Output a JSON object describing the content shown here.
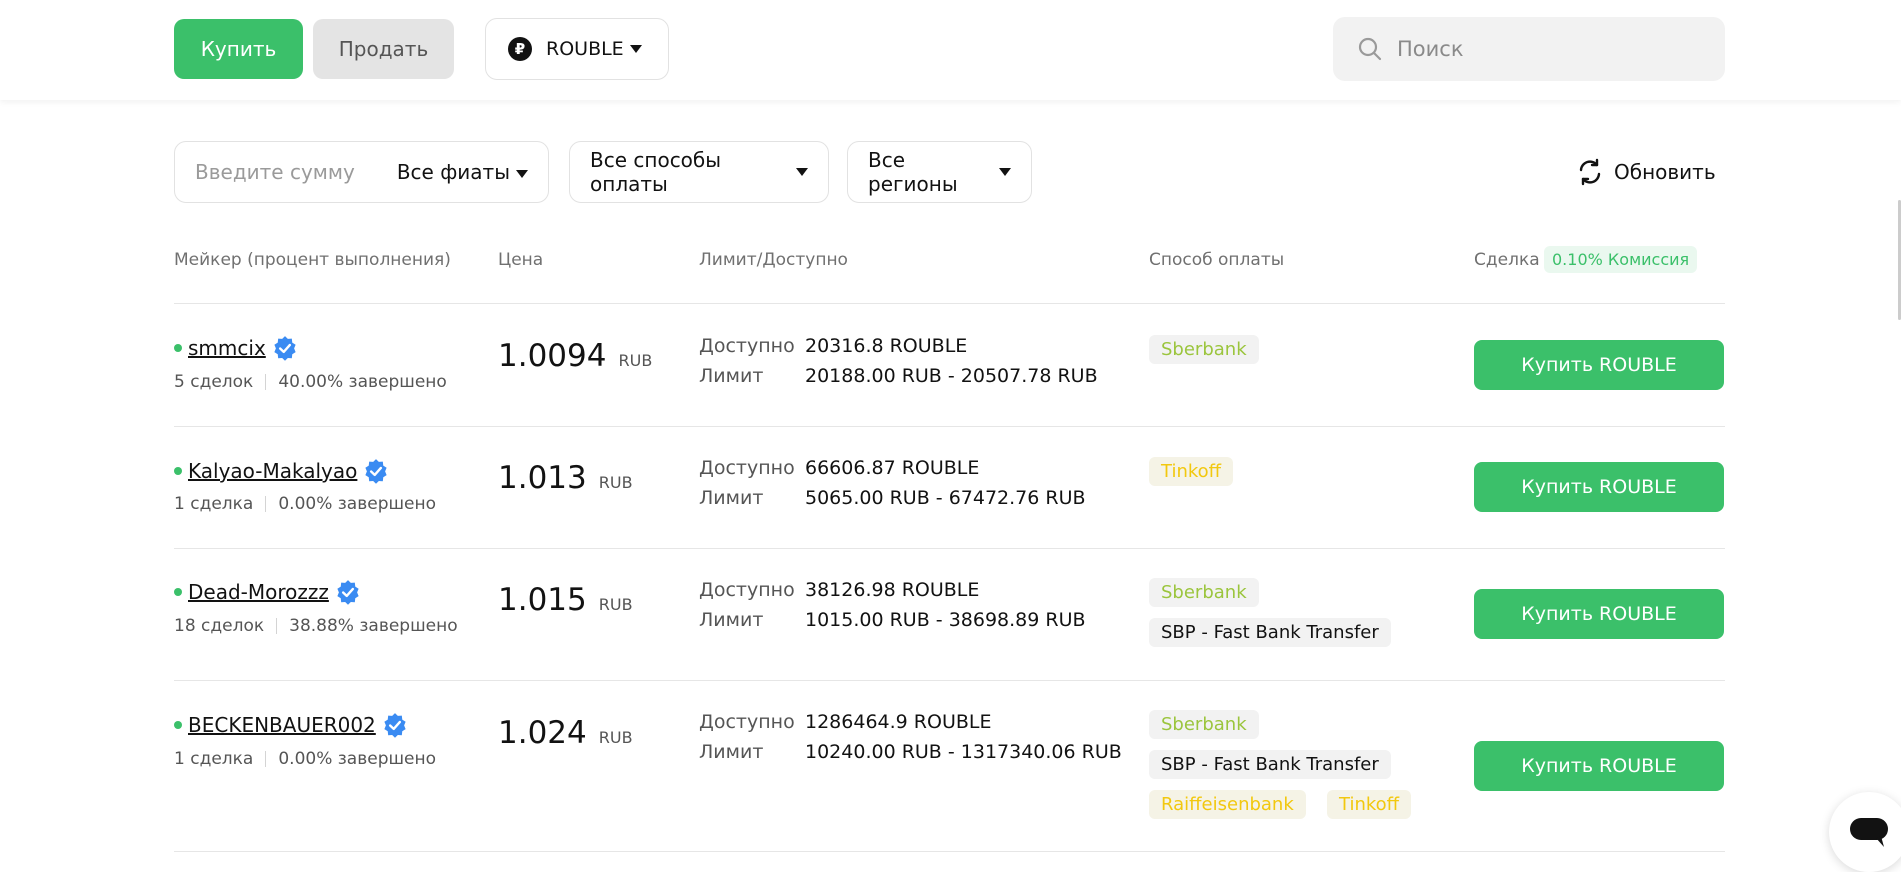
{
  "topbar": {
    "buy_label": "Купить",
    "sell_label": "Продать",
    "currency_label": "ROUBLE",
    "search_placeholder": "Поиск"
  },
  "filters": {
    "amount_placeholder": "Введите сумму",
    "fiat_label": "Все фиаты",
    "payment_label": "Все способы оплаты",
    "region_label": "Все регионы",
    "refresh_label": "Обновить"
  },
  "table": {
    "headers": {
      "maker": "Мейкер (процент выполнения)",
      "price": "Цена",
      "limit": "Лимит/Доступно",
      "payment": "Способ оплаты",
      "deal": "Сделка",
      "fee": "0.10% Комиссия"
    },
    "labels": {
      "available": "Доступно",
      "limit": "Лимит"
    },
    "rows": [
      {
        "name": "smmcix",
        "deals": "5 сделок",
        "completion": "40.00% завершено",
        "price": "1.0094",
        "unit": "RUB",
        "available": "20316.8 ROUBLE",
        "limit": "20188.00 RUB - 20507.78 RUB",
        "payments": [
          "Sberbank"
        ],
        "action": "Купить ROUBLE"
      },
      {
        "name": "Kalyao-Makalyao",
        "deals": "1 сделка",
        "completion": "0.00% завершено",
        "price": "1.013",
        "unit": "RUB",
        "available": "66606.87 ROUBLE",
        "limit": "5065.00 RUB - 67472.76 RUB",
        "payments": [
          "Tinkoff"
        ],
        "action": "Купить ROUBLE"
      },
      {
        "name": "Dead-Morozzz",
        "deals": "18 сделок",
        "completion": "38.88% завершено",
        "price": "1.015",
        "unit": "RUB",
        "available": "38126.98 ROUBLE",
        "limit": "1015.00 RUB - 38698.89 RUB",
        "payments": [
          "Sberbank",
          "SBP - Fast Bank Transfer"
        ],
        "action": "Купить ROUBLE"
      },
      {
        "name": "BECKENBAUER002",
        "deals": "1 сделка",
        "completion": "0.00% завершено",
        "price": "1.024",
        "unit": "RUB",
        "available": "1286464.9 ROUBLE",
        "limit": "10240.00 RUB - 1317340.06 RUB",
        "payments": [
          "Sberbank",
          "SBP - Fast Bank Transfer",
          "Raiffeisenbank",
          "Tinkoff"
        ],
        "action": "Купить ROUBLE"
      }
    ]
  }
}
